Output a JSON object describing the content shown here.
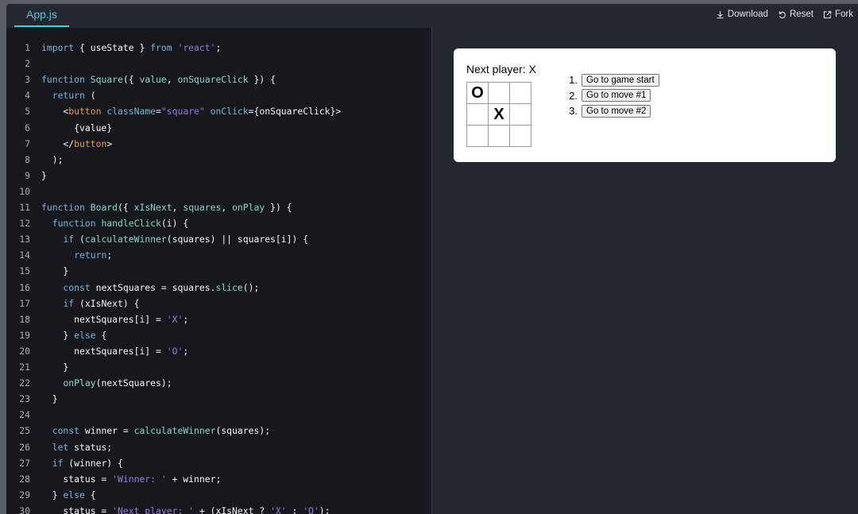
{
  "tabs": {
    "active": "App.js"
  },
  "actions": {
    "download": "Download",
    "reset": "Reset",
    "fork": "Fork"
  },
  "code": {
    "lines": [
      {
        "n": "1",
        "html": "<span class='kw'>import</span> { useState } <span class='kw'>from</span> <span class='str'>'react'</span>;"
      },
      {
        "n": "2",
        "html": ""
      },
      {
        "n": "3",
        "html": "<span class='kw'>function</span> <span class='fn'>Square</span>({ <span class='prm'>value</span>, <span class='prm'>onSquareClick</span> }) {"
      },
      {
        "n": "4",
        "html": "  <span class='kw'>return</span> ("
      },
      {
        "n": "5",
        "html": "    &lt;<span class='tag'>button</span> <span class='attr'>className</span>=<span class='str'>\"square\"</span> <span class='attr'>onClick</span>={onSquareClick}&gt;"
      },
      {
        "n": "6",
        "html": "      {value}"
      },
      {
        "n": "7",
        "html": "    &lt;/<span class='tag'>button</span>&gt;"
      },
      {
        "n": "8",
        "html": "  );"
      },
      {
        "n": "9",
        "html": "}"
      },
      {
        "n": "10",
        "html": ""
      },
      {
        "n": "11",
        "html": "<span class='kw'>function</span> <span class='fn'>Board</span>({ <span class='prm'>xIsNext</span>, <span class='prm'>squares</span>, <span class='prm'>onPlay</span> }) {"
      },
      {
        "n": "12",
        "html": "  <span class='kw'>function</span> <span class='fn'>handleClick</span>(i) {"
      },
      {
        "n": "13",
        "html": "    <span class='kw'>if</span> (<span class='fn'>calculateWinner</span>(squares) || squares[i]) {"
      },
      {
        "n": "14",
        "html": "      <span class='kw'>return</span>;"
      },
      {
        "n": "15",
        "html": "    }"
      },
      {
        "n": "16",
        "html": "    <span class='kw'>const</span> nextSquares = squares.<span class='fn'>slice</span>();"
      },
      {
        "n": "17",
        "html": "    <span class='kw'>if</span> (xIsNext) {"
      },
      {
        "n": "18",
        "html": "      nextSquares[i] = <span class='str'>'X'</span>;"
      },
      {
        "n": "19",
        "html": "    } <span class='kw'>else</span> {"
      },
      {
        "n": "20",
        "html": "      nextSquares[i] = <span class='str'>'O'</span>;"
      },
      {
        "n": "21",
        "html": "    }"
      },
      {
        "n": "22",
        "html": "    <span class='fn'>onPlay</span>(nextSquares);"
      },
      {
        "n": "23",
        "html": "  }"
      },
      {
        "n": "24",
        "html": ""
      },
      {
        "n": "25",
        "html": "  <span class='kw'>const</span> winner = <span class='fn'>calculateWinner</span>(squares);"
      },
      {
        "n": "26",
        "html": "  <span class='kw'>let</span> status;"
      },
      {
        "n": "27",
        "html": "  <span class='kw'>if</span> (winner) {"
      },
      {
        "n": "28",
        "html": "    status = <span class='str'>'Winner: '</span> + winner;"
      },
      {
        "n": "29",
        "html": "  } <span class='kw'>else</span> {"
      },
      {
        "n": "30",
        "html": "    status = <span class='str'>'Next player: '</span> + (xIsNext ? <span class='str'>'X'</span> : <span class='str'>'O'</span>);"
      }
    ]
  },
  "preview": {
    "status": "Next player: X",
    "squares": [
      "O",
      "",
      "",
      "",
      "X",
      "",
      "",
      "",
      ""
    ],
    "moves": [
      {
        "num": "1.",
        "label": "Go to game start"
      },
      {
        "num": "2.",
        "label": "Go to move #1"
      },
      {
        "num": "3.",
        "label": "Go to move #2"
      }
    ]
  }
}
